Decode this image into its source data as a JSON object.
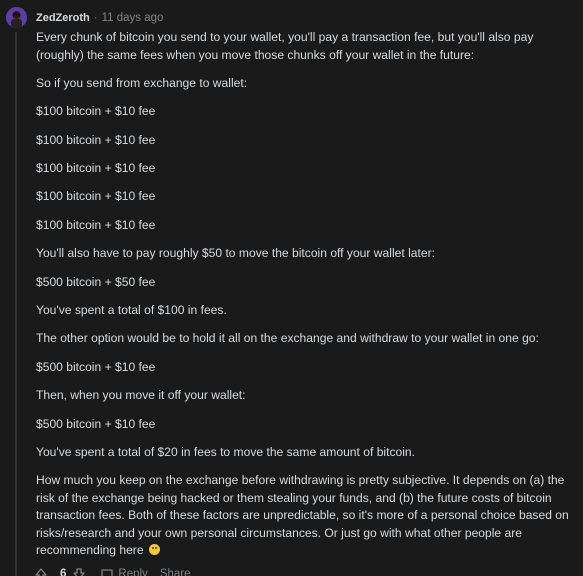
{
  "comment": {
    "username": "ZedZeroth",
    "separator": "·",
    "timestamp": "11 days ago",
    "paragraphs": [
      "Every chunk of bitcoin you send to your wallet, you'll pay a transaction fee, but you'll also pay (roughly) the same fees when you move those chunks off your wallet in the future:",
      "So if you send from exchange to wallet:",
      "$100 bitcoin + $10 fee",
      "$100 bitcoin + $10 fee",
      "$100 bitcoin + $10 fee",
      "$100 bitcoin + $10 fee",
      "$100 bitcoin + $10 fee",
      "You'll also have to pay roughly $50 to move the bitcoin off your wallet later:",
      "$500 bitcoin + $50 fee",
      "You've spent a total of $100 in fees.",
      "The other option would be to hold it all on the exchange and withdraw to your wallet in one go:",
      "$500 bitcoin + $10 fee",
      "Then, when you move it off your wallet:",
      "$500 bitcoin + $10 fee",
      "You've spent a total of $20 in fees to move the same amount of bitcoin.",
      "How much you keep on the exchange before withdrawing is pretty subjective. It depends on (a) the risk of the exchange being hacked or them stealing your funds, and (b) the future costs of bitcoin transaction fees. Both of these factors are unpredictable, so it's more of a personal choice based on risks/research and your own personal circumstances. Or just go with what other people are recommending here"
    ],
    "emoji": "slightly-smiling-face"
  },
  "actions": {
    "vote_count": "6",
    "reply_label": "Reply",
    "share_label": "Share"
  },
  "colors": {
    "background": "#1a1a1b",
    "text": "#d7dadc",
    "muted": "#818384",
    "thread_line": "#343536"
  }
}
